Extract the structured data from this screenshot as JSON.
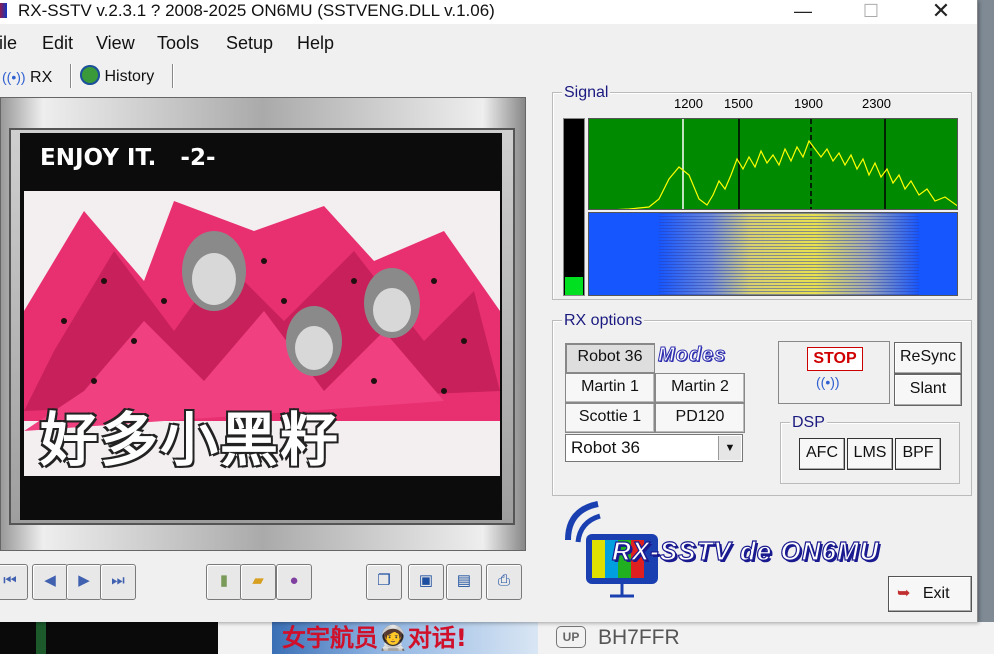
{
  "window": {
    "title": "RX-SSTV v.2.3.1 ? 2008-2025 ON6MU (SSTVENG.DLL v.1.06)",
    "controls": {
      "minimize": "—",
      "maximize": "☐",
      "close": "✕"
    }
  },
  "menu": [
    "ile",
    "Edit",
    "View",
    "Tools",
    "Setup",
    "Help"
  ],
  "tabs": {
    "rx": "RX",
    "history": "History"
  },
  "image": {
    "caption": "ENJOY IT.   -2-",
    "overlay_text": "好多小黑籽"
  },
  "signal": {
    "label": "Signal",
    "freq_ticks": [
      "1200",
      "1500",
      "1900",
      "2300"
    ],
    "level_fraction": 0.1
  },
  "rx_options": {
    "label": "RX options",
    "modes_logo": "Modes",
    "mode_buttons": [
      "Robot 36",
      "Martin 1",
      "Martin 2",
      "Scottie 1",
      "PD120"
    ],
    "selected_mode": "Robot 36",
    "stop": "STOP",
    "resync": "ReSync",
    "slant": "Slant",
    "dsp": {
      "label": "DSP",
      "buttons": [
        "AFC",
        "LMS",
        "BPF"
      ]
    }
  },
  "logo_text": "RX-SSTV de ON6MU",
  "exit": "Exit",
  "background": {
    "banner_text": "女宇航员",
    "banner_text2": "对话!",
    "up_badge": "UP",
    "username": "BH7FFR"
  },
  "colors": {
    "spectrum_bg": "#008a00",
    "spectrum_line": "#ffff00",
    "waterfall_bg": "#1556ff",
    "stop_red": "#d00000",
    "label_blue": "#1a1a80"
  }
}
